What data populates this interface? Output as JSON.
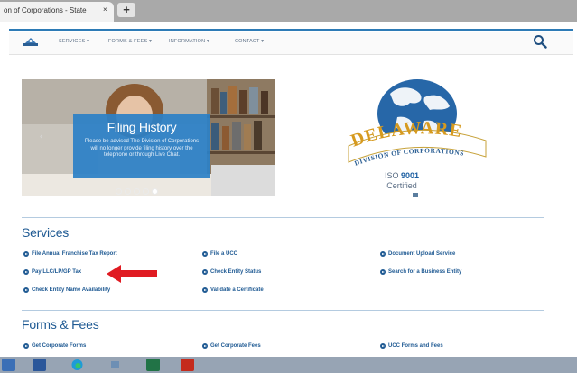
{
  "browser": {
    "tab_title": "on of Corporations - State",
    "tab_close": "×",
    "new_tab": "+"
  },
  "nav": {
    "items": [
      "SERVICES",
      "FORMS & FEES",
      "INFORMATION",
      "CONTACT"
    ],
    "dropdown_glyph": "▾"
  },
  "hero": {
    "title": "Filing History",
    "text": "Please be advised The Division of Corporations will no longer provide filing history over the telephone or through Live Chat.",
    "prev_glyph": "‹"
  },
  "seal": {
    "banner": "DELAWARE",
    "subtitle": "DIVISION OF CORPORATIONS"
  },
  "iso": {
    "prefix": "ISO",
    "number": "9001",
    "certified": "Certified"
  },
  "services": {
    "title": "Services",
    "links": [
      "File Annual Franchise Tax Report",
      "File a UCC",
      "Document Upload Service",
      "Pay LLC/LP/GP Tax",
      "Check Entity Status",
      "Search for a Business Entity",
      "Check Entity Name Availability",
      "Validate a Certificate"
    ]
  },
  "forms": {
    "title": "Forms & Fees",
    "links": [
      "Get Corporate Forms",
      "Get Corporate Fees",
      "UCC Forms and Fees"
    ]
  },
  "colors": {
    "brand_blue": "#1f5a93",
    "accent_blue": "#2c80c6",
    "arrow_red": "#e01b22"
  }
}
